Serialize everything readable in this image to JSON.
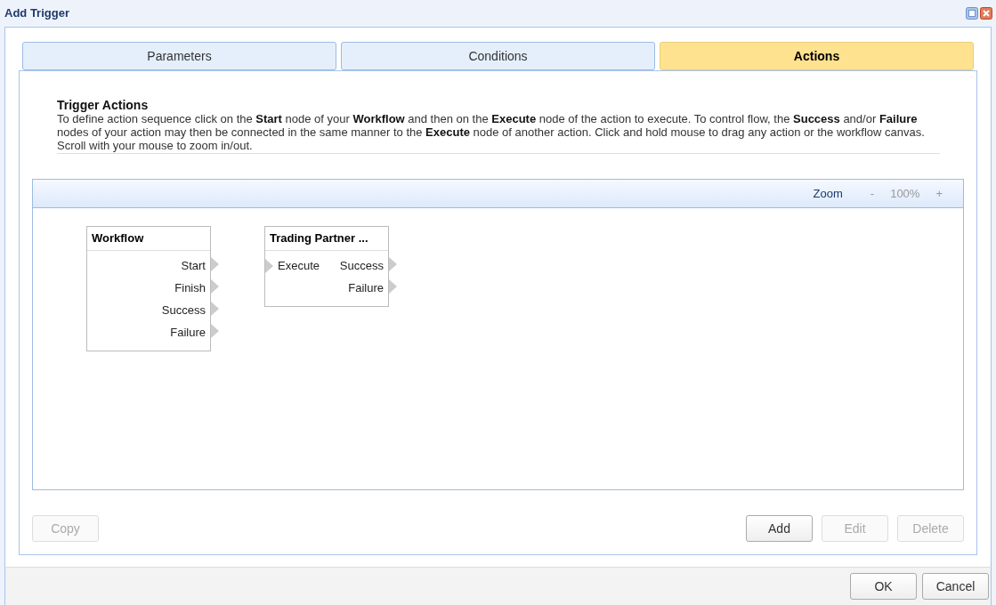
{
  "window": {
    "title": "Add Trigger"
  },
  "tabs": [
    {
      "label": "Parameters",
      "selected": false
    },
    {
      "label": "Conditions",
      "selected": false
    },
    {
      "label": "Actions",
      "selected": true
    }
  ],
  "section": {
    "title": "Trigger Actions",
    "description": "To define action sequence click on the **Start** node of your **Workflow** and then on the **Execute** node of the action to execute. To control flow, the **Success** and/or **Failure** nodes of your action may then be connected in the same manner to the **Execute** node of another action. Click and hold mouse to drag any action or the workflow canvas. Scroll with your mouse to zoom in/out."
  },
  "zoom": {
    "label": "Zoom",
    "minus": "-",
    "value": "100%",
    "plus": "+"
  },
  "nodes": [
    {
      "title": "Workflow",
      "rows": [
        {
          "output": "Start"
        },
        {
          "output": "Finish"
        },
        {
          "output": "Success"
        },
        {
          "output": "Failure"
        }
      ]
    },
    {
      "title": "Trading Partner ...",
      "rows": [
        {
          "input": "Execute",
          "output": "Success"
        },
        {
          "output": "Failure"
        }
      ]
    }
  ],
  "left_buttons": [
    {
      "label": "Copy",
      "disabled": true
    }
  ],
  "right_buttons": [
    {
      "label": "Add",
      "disabled": false
    },
    {
      "label": "Edit",
      "disabled": true
    },
    {
      "label": "Delete",
      "disabled": true
    }
  ],
  "footer_buttons": [
    {
      "label": "OK"
    },
    {
      "label": "Cancel"
    }
  ]
}
